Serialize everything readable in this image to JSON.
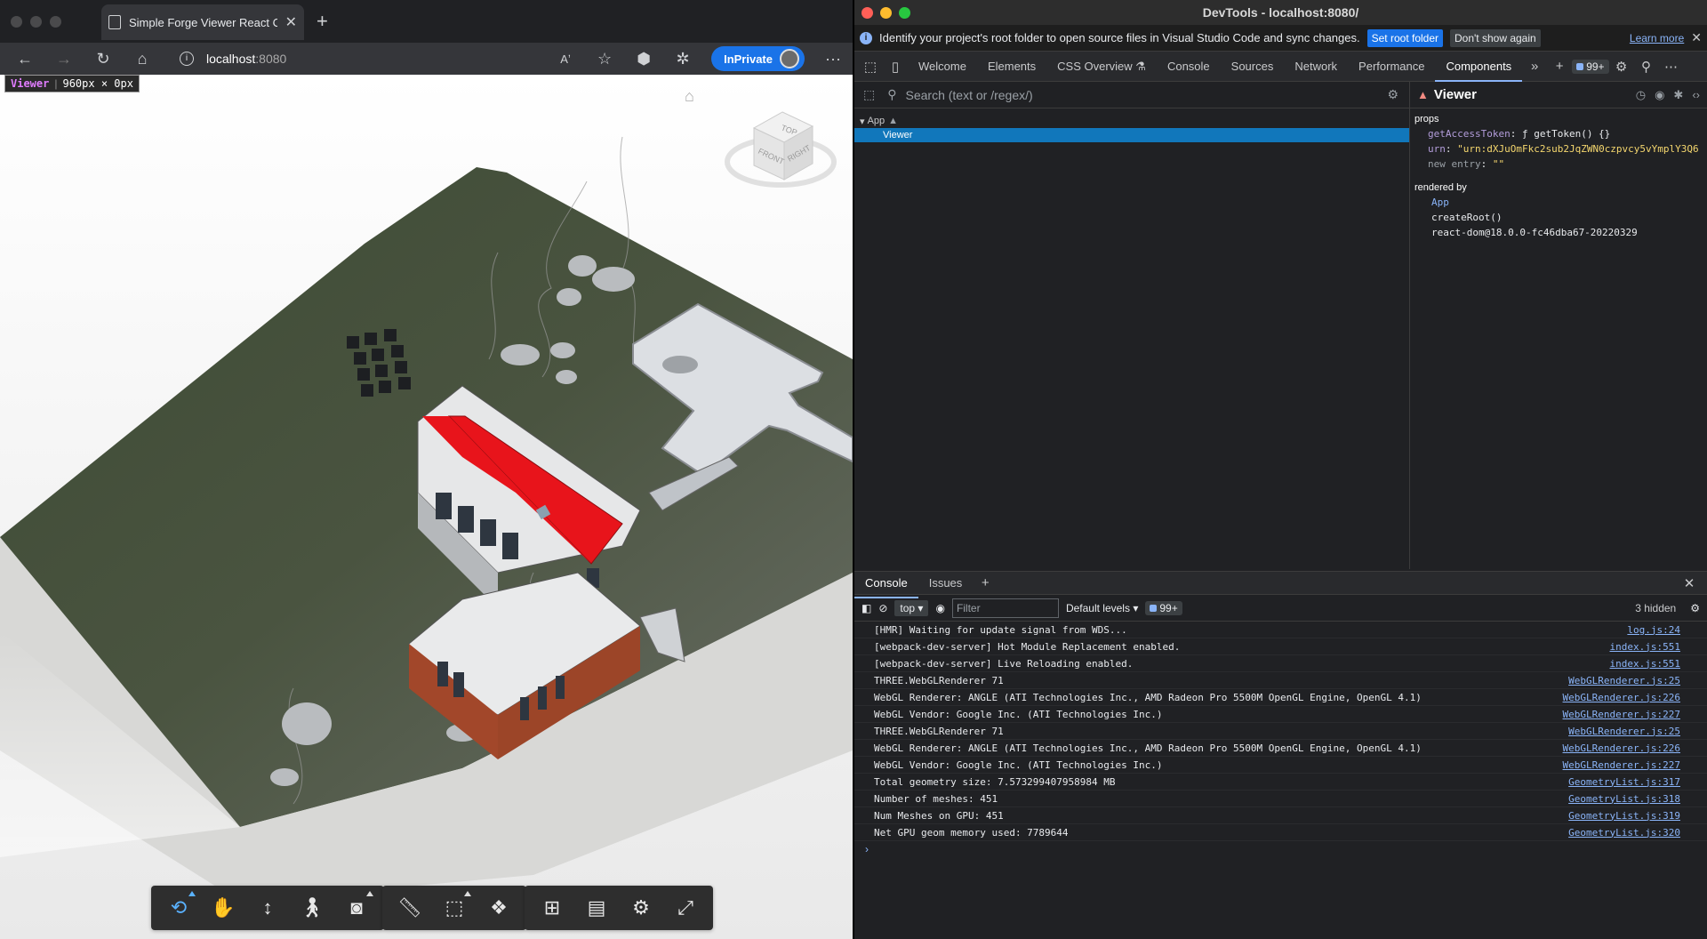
{
  "browser": {
    "tab_title": "Simple Forge Viewer React Co",
    "url_host": "localhost",
    "url_port": ":8080",
    "inprivate_label": "InPrivate",
    "more_label": "···",
    "viewer_badge_name": "Viewer",
    "viewer_badge_size": "960px × 0px"
  },
  "viewcube": {
    "top": "TOP",
    "front": "FRONT",
    "right": "RIGHT"
  },
  "toolbar_groups": [
    {
      "items": [
        "orbit-icon",
        "pan-icon",
        "zoom-icon",
        "first-person-icon",
        "camera-icon"
      ]
    },
    {
      "items": [
        "measure-icon",
        "section-icon",
        "explode-icon"
      ]
    },
    {
      "items": [
        "model-browser-icon",
        "properties-icon",
        "settings-icon",
        "fullscreen-icon"
      ]
    }
  ],
  "devtools": {
    "title": "DevTools - localhost:8080/",
    "info_text": "Identify your project's root folder to open source files in Visual Studio Code and sync changes.",
    "set_root_label": "Set root folder",
    "dont_show_label": "Don't show again",
    "learn_more_label": "Learn more",
    "tabs": [
      "Welcome",
      "Elements",
      "CSS Overview ⚗",
      "Console",
      "Sources",
      "Network",
      "Performance",
      "Components"
    ],
    "active_tab": "Components",
    "issues_count": "99+",
    "search_placeholder": "Search (text or /regex/)",
    "tree": {
      "app": "App",
      "viewer": "Viewer"
    },
    "props": {
      "component_name": "Viewer",
      "section_props": "props",
      "k1": "getAccessToken",
      "v1": "ƒ getToken() {}",
      "k2": "urn",
      "v2": "\"urn:dXJuOmFkc2sub2JqZWN0czpvcy5vYmplY3Q6",
      "k3": "new entry",
      "v3": "\"\"",
      "section_rendered": "rendered by",
      "rb_app": "App",
      "rb_root": "createRoot()",
      "rb_dom": "react-dom@18.0.0-fc46dba67-20220329"
    },
    "drawer_tabs": [
      "Console",
      "Issues"
    ],
    "console_context": "top",
    "filter_placeholder": "Filter",
    "levels_label": "Default levels",
    "console_issues": "99+",
    "hidden_label": "3 hidden",
    "logs": [
      {
        "msg": "[HMR] Waiting for update signal from WDS...",
        "src": "log.js:24"
      },
      {
        "msg": "[webpack-dev-server] Hot Module Replacement enabled.",
        "src": "index.js:551"
      },
      {
        "msg": "[webpack-dev-server] Live Reloading enabled.",
        "src": "index.js:551"
      },
      {
        "msg": "THREE.WebGLRenderer 71",
        "src": "WebGLRenderer.js:25"
      },
      {
        "msg": "WebGL Renderer: ANGLE (ATI Technologies Inc., AMD Radeon Pro 5500M OpenGL Engine, OpenGL 4.1)",
        "src": "WebGLRenderer.js:226"
      },
      {
        "msg": "WebGL Vendor: Google Inc. (ATI Technologies Inc.)",
        "src": "WebGLRenderer.js:227"
      },
      {
        "msg": "THREE.WebGLRenderer 71",
        "src": "WebGLRenderer.js:25"
      },
      {
        "msg": "WebGL Renderer: ANGLE (ATI Technologies Inc., AMD Radeon Pro 5500M OpenGL Engine, OpenGL 4.1)",
        "src": "WebGLRenderer.js:226"
      },
      {
        "msg": "WebGL Vendor: Google Inc. (ATI Technologies Inc.)",
        "src": "WebGLRenderer.js:227"
      },
      {
        "msg": "Total geometry size: 7.573299407958984 MB",
        "src": "GeometryList.js:317"
      },
      {
        "msg": "Number of meshes: 451",
        "src": "GeometryList.js:318"
      },
      {
        "msg": "Num Meshes on GPU: 451",
        "src": "GeometryList.js:319"
      },
      {
        "msg": "Net GPU geom memory used: 7789644",
        "src": "GeometryList.js:320"
      }
    ]
  }
}
